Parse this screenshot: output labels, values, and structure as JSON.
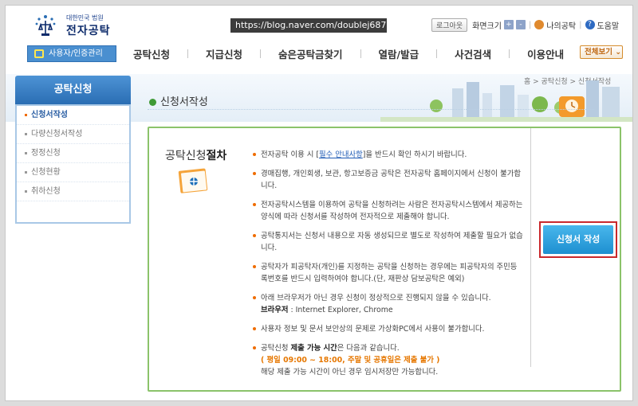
{
  "header": {
    "logo_court": "대한민국 법원",
    "logo_name": "전자공탁",
    "url": "https://blog.naver.com/doublej6871",
    "logout": "로그아웃",
    "screen_size": "화면크기",
    "zoom_in": "+",
    "zoom_out": "-",
    "my_gongtak": "나의공탁",
    "help": "도움말"
  },
  "nav": {
    "login_tab": "사용자/인증관리",
    "items": [
      "공탁신청",
      "지급신청",
      "숨은공탁금찾기",
      "열람/발급",
      "사건검색",
      "이용안내"
    ],
    "all_view": "전체보기"
  },
  "sidebar": {
    "title": "공탁신청",
    "items": [
      {
        "label": "신청서작성",
        "active": true
      },
      {
        "label": "다량신청서작성",
        "active": false
      },
      {
        "label": "정정신청",
        "active": false
      },
      {
        "label": "신청현황",
        "active": false
      },
      {
        "label": "취하신청",
        "active": false
      }
    ]
  },
  "page": {
    "title": "신청서작성",
    "breadcrumb": "홈 > 공탁신청 > 신청서작성"
  },
  "procedure": {
    "title_prefix": "공탁신청",
    "title_bold": "절차",
    "notices": {
      "n1_pre": "전자공탁 이용 시 [",
      "n1_link": "필수 안내사항",
      "n1_post": "]을 반드시 확인 하시기 바랍니다.",
      "n2": "경매집행, 개인회생, 보관, 항고보증금 공탁은 전자공탁 홈페이지에서 신청이 불가합니다.",
      "n3": "전자공탁시스템을 이용하여 공탁을 신청하려는 사람은 전자공탁시스템에서 제공하는 양식에 따라 신청서를 작성하여 전자적으로 제출해야 합니다.",
      "n4": "공탁통지서는 신청서 내용으로 자동 생성되므로 별도로 작성하여 제출할 필요가 없습니다.",
      "n5": "공탁자가 피공탁자(개인)를 지정하는 공탁을 신청하는 경우에는 피공탁자의 주민등록번호를 반드시 입력하여야 합니다.(단, 재판상 담보공탁은 예외)",
      "n6_line1": "아래 브라우저가 아닌 경우 신청이 정상적으로 진행되지 않을 수 있습니다.",
      "n6_label": "브라우저",
      "n6_value": " : Internet Explorer, Chrome",
      "n7": "사용자 정보 및 문서 보안상의 문제로 가상화PC에서 사용이 불가합니다.",
      "n8_pre": "공탁신청 ",
      "n8_bold": "제출 가능 시간",
      "n8_post": "은 다음과 같습니다.",
      "n8_hours": "( 평일 09:00 ~ 18:00, 주말 및 공휴일은 제출 불가 )",
      "n8_note": "해당 제출 가능 시간이 아닌 경우 임시저장만 가능합니다."
    },
    "apply_button": "신청서 작성"
  },
  "colors": {
    "accent_blue": "#2a6db3",
    "green_border": "#8bc36a",
    "highlight_red": "#c9282c",
    "orange_text": "#e67700"
  }
}
